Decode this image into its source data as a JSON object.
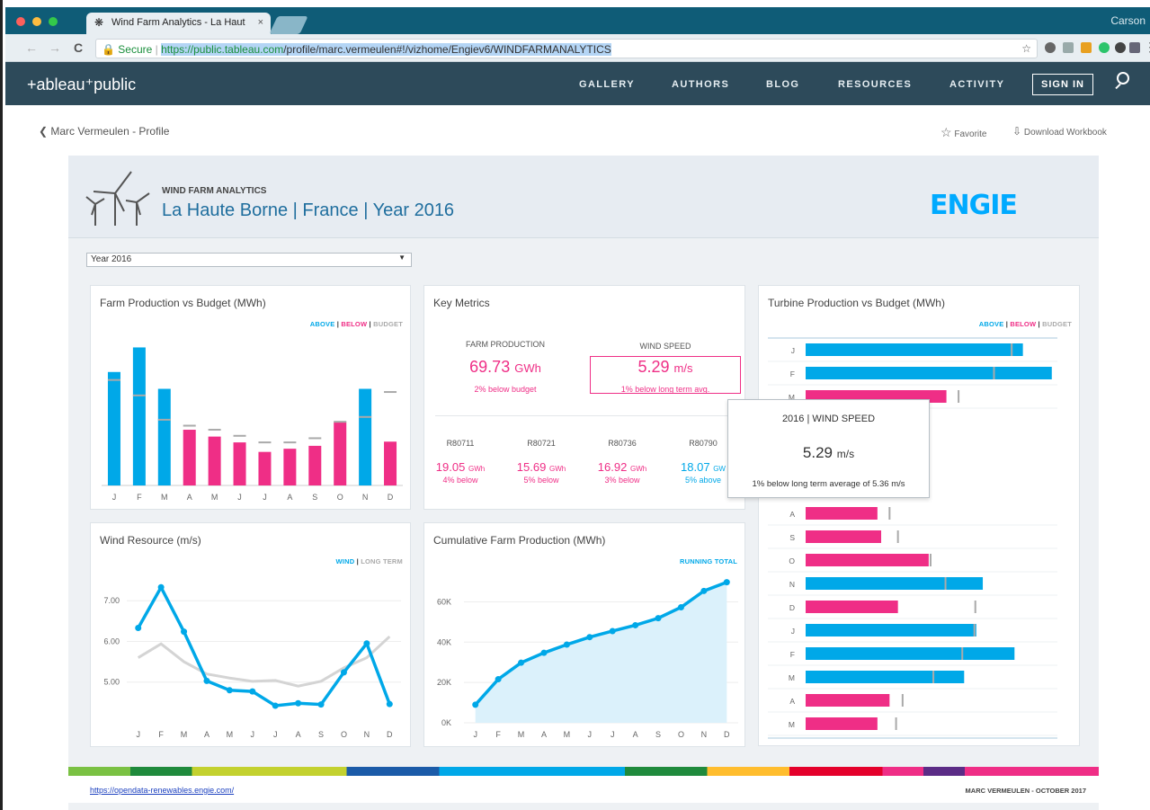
{
  "browser": {
    "tab_title": "Wind Farm Analytics - La Haut",
    "tab_close": "×",
    "profile_name": "Carson",
    "secure_label": "Secure",
    "url_host": "https://public.tableau.com",
    "url_path": "/profile/marc.vermeulen#!/vizhome/Engiev6/WINDFARMANALYTICS"
  },
  "site_nav": {
    "logo": "+ableau⁺public",
    "items": [
      "GALLERY",
      "AUTHORS",
      "BLOG",
      "RESOURCES",
      "ACTIVITY"
    ],
    "signin": "SIGN IN"
  },
  "profile_bar": {
    "back_label": "Marc Vermeulen - Profile",
    "favorite_label": "Favorite",
    "download_label": "Download Workbook"
  },
  "dashboard": {
    "subtitle": "WIND FARM ANALYTICS",
    "title": "La Haute Borne | France | Year 2016",
    "brand": "ENGIE",
    "year_filter": "Year 2016",
    "footer_link": "https://opendata-renewables.engie.com/",
    "footer_credit": "MARC VERMEULEN - OCTOBER 2017",
    "colors": {
      "above": "#00a8e8",
      "below": "#ef2e86",
      "budget": "#aaaaaa"
    }
  },
  "key_metrics": {
    "title": "Key Metrics",
    "farm_production_label": "FARM PRODUCTION",
    "farm_production_value": "69.73",
    "farm_production_unit": "GWh",
    "farm_production_note": "2% below budget",
    "wind_speed_label": "WIND SPEED",
    "wind_speed_value": "5.29",
    "wind_speed_unit": "m/s",
    "wind_speed_note": "1% below long term avg.",
    "turbines": [
      {
        "id": "R80711",
        "value": "19.05",
        "unit": "GWh",
        "note": "4% below",
        "status": "below"
      },
      {
        "id": "R80721",
        "value": "15.69",
        "unit": "GWh",
        "note": "5% below",
        "status": "below"
      },
      {
        "id": "R80736",
        "value": "16.92",
        "unit": "GWh",
        "note": "3% below",
        "status": "below"
      },
      {
        "id": "R80790",
        "value": "18.07",
        "unit": "GW",
        "note": "5% above",
        "status": "above"
      }
    ]
  },
  "tooltip": {
    "header": "2016 | WIND SPEED",
    "value": "5.29",
    "unit": "m/s",
    "note": "1% below long term average of 5.36 m/s"
  },
  "chart_data": [
    {
      "type": "bar",
      "title": "Farm Production vs Budget (MWh)",
      "legend": [
        "ABOVE",
        "BELOW",
        "BUDGET"
      ],
      "categories": [
        "J",
        "F",
        "M",
        "A",
        "M",
        "J",
        "J",
        "A",
        "S",
        "O",
        "N",
        "D"
      ],
      "series": [
        {
          "name": "ABOVE",
          "values": [
            8960,
            10900,
            7630,
            null,
            null,
            null,
            null,
            null,
            null,
            null,
            7630,
            null
          ]
        },
        {
          "name": "BELOW",
          "values": [
            null,
            null,
            null,
            4400,
            3860,
            3400,
            2650,
            2900,
            3130,
            5010,
            null,
            3460
          ]
        },
        {
          "name": "BUDGET",
          "values": [
            8330,
            7110,
            5190,
            4720,
            4400,
            3920,
            3400,
            3400,
            3730,
            5030,
            5410,
            7380
          ]
        }
      ],
      "ylim": [
        0,
        11500
      ]
    },
    {
      "type": "line",
      "title": "Wind Resource (m/s)",
      "legend": [
        "WIND",
        "LONG TERM"
      ],
      "categories": [
        "J",
        "F",
        "M",
        "A",
        "M",
        "J",
        "J",
        "A",
        "S",
        "O",
        "N",
        "D"
      ],
      "yticks": [
        "7.00",
        "6.00",
        "5.00"
      ],
      "series": [
        {
          "name": "WIND",
          "values": [
            6.33,
            7.33,
            6.24,
            5.03,
            4.8,
            4.77,
            4.42,
            4.48,
            4.45,
            5.24,
            5.95,
            4.46
          ]
        },
        {
          "name": "LONG TERM",
          "values": [
            5.6,
            5.94,
            5.5,
            5.2,
            5.1,
            5.02,
            5.04,
            4.9,
            5.02,
            5.35,
            5.6,
            6.12
          ]
        }
      ],
      "ylim": [
        4.0,
        7.8
      ]
    },
    {
      "type": "area",
      "title": "Cumulative Farm Production (MWh)",
      "legend": [
        "RUNNING TOTAL"
      ],
      "categories": [
        "J",
        "F",
        "M",
        "A",
        "M",
        "J",
        "J",
        "A",
        "S",
        "O",
        "N",
        "D"
      ],
      "yticks": [
        "60K",
        "40K",
        "20K",
        "0K"
      ],
      "series": [
        {
          "name": "RUNNING TOTAL",
          "values": [
            8960,
            21600,
            29800,
            34700,
            38800,
            42500,
            45500,
            48400,
            51900,
            57300,
            65400,
            69730
          ]
        }
      ],
      "ylim": [
        0,
        70000
      ]
    },
    {
      "type": "bar",
      "title": "Turbine Production vs Budget (MWh)",
      "legend": [
        "ABOVE",
        "BELOW",
        "BUDGET"
      ],
      "categories": [
        "J",
        "F",
        "M",
        "A",
        "S",
        "O",
        "N",
        "D",
        "J",
        "F",
        "M",
        "A",
        "M"
      ],
      "series": [
        {
          "name": "VALUE",
          "values": [
            2330,
            2640,
            1510,
            770,
            810,
            1320,
            1900,
            990,
            1830,
            2240,
            1700,
            900,
            770
          ]
        },
        {
          "name": "BUDGET",
          "values": [
            2210,
            2020,
            1640,
            900,
            990,
            1340,
            1500,
            1820,
            1810,
            1680,
            1370,
            1040,
            970
          ]
        },
        {
          "name": "STATUS",
          "values": [
            "above",
            "above",
            "below",
            "below",
            "below",
            "below",
            "above",
            "below",
            "above",
            "above",
            "above",
            "below",
            "below"
          ]
        }
      ],
      "xlim": [
        0,
        2700
      ]
    }
  ]
}
